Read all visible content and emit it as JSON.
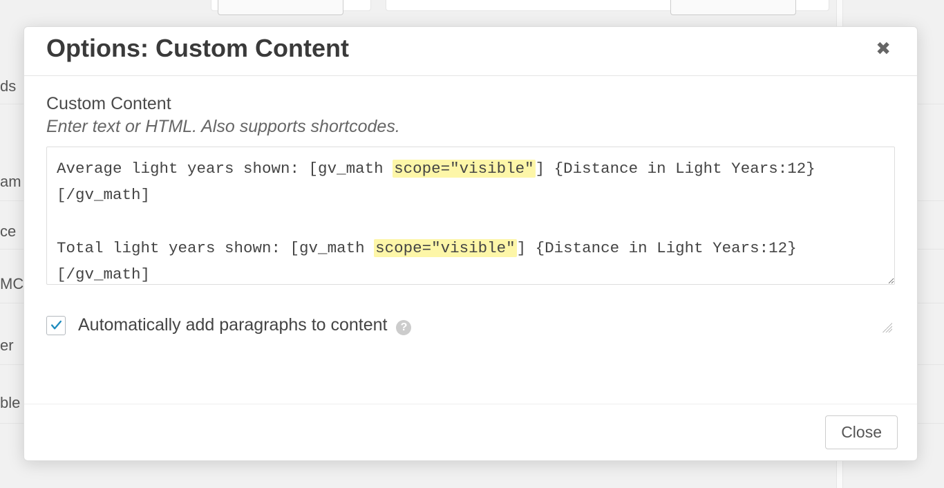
{
  "modal": {
    "title": "Options: Custom Content",
    "close_icon": "✖",
    "field_label": "Custom Content",
    "field_hint": "Enter text or HTML. Also supports shortcodes.",
    "content_lines": [
      {
        "pre": "Average light years shown: [gv_math ",
        "hl": "scope=\"visible\"",
        "post": "] {Distance in Light Years:12} [/gv_math]"
      },
      {
        "pre": "",
        "hl": "",
        "post": ""
      },
      {
        "pre": "Total light years shown: [gv_math ",
        "hl": "scope=\"visible\"",
        "post": "] {Distance in Light Years:12} [/gv_math]"
      }
    ],
    "checkbox": {
      "checked": true,
      "label": "Automatically add paragraphs to content"
    },
    "help_icon": "?",
    "close_button": "Close"
  },
  "background": {
    "sidebar_fragments": [
      "ds",
      "am",
      "ce",
      "MC",
      "er",
      "ble"
    ]
  }
}
